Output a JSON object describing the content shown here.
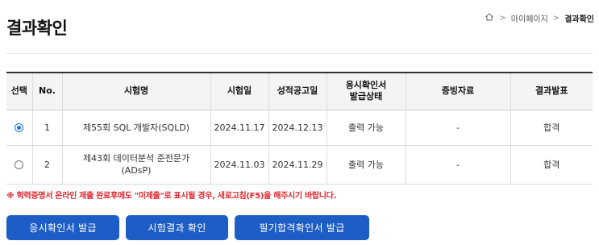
{
  "header": {
    "title": "결과확인",
    "breadcrumb": {
      "home_icon": "home-icon",
      "separator": ">",
      "items": [
        "마이페이지",
        "결과확인"
      ]
    }
  },
  "table": {
    "headers": {
      "select": "선택",
      "no": "No.",
      "exam_name": "시험명",
      "exam_date": "시험일",
      "result_date": "성적공고일",
      "cert_status_line1": "응시확인서",
      "cert_status_line2": "발급상태",
      "evidence": "증빙자료",
      "result": "결과발표"
    },
    "rows": [
      {
        "selected": true,
        "no": "1",
        "exam_name": "제55회 SQL 개발자(SQLD)",
        "exam_date": "2024.11.17",
        "result_date": "2024.12.13",
        "cert_status": "출력 가능",
        "evidence": "-",
        "result": "합격"
      },
      {
        "selected": false,
        "no": "2",
        "exam_name_line1": "제43회 데이터분석 준전문가",
        "exam_name_line2": "(ADsP)",
        "exam_date": "2024.11.03",
        "result_date": "2024.11.29",
        "cert_status": "출력 가능",
        "evidence": "-",
        "result": "합격"
      }
    ]
  },
  "notice": "※ 학력증명서 온라인 제출 완료후에도 \"미제출\"로 표시될 경우, 새로고침(F5)을 해주시기 바랍니다.",
  "buttons": {
    "issue_cert": "응시확인서 발급",
    "check_result": "시험결과 확인",
    "written_pass_cert": "필기합격확인서 발급"
  },
  "colors": {
    "primary_button": "#1d5dc6",
    "notice_text": "#e0262d",
    "radio_selected": "#1a73e8"
  }
}
